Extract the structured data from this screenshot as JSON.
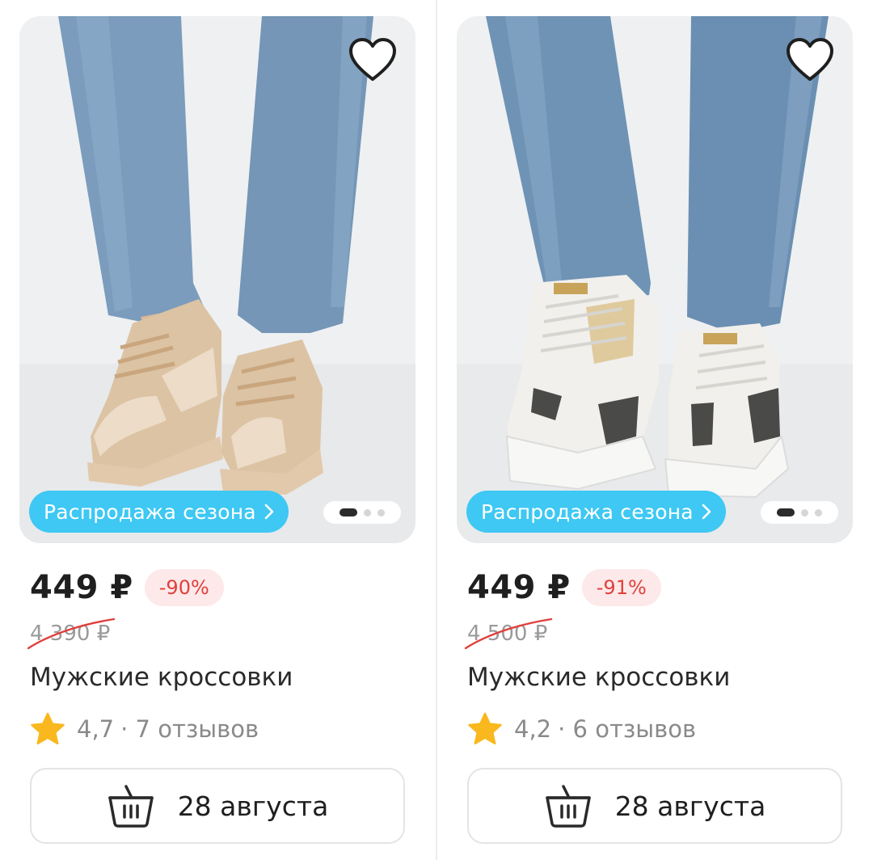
{
  "products": [
    {
      "promo_label": "Распродажа сезона",
      "price": "449 ₽",
      "discount": "-90%",
      "old_price": "4 390 ₽",
      "title": "Мужские кроссовки",
      "rating": "4,7",
      "reviews": "· 7 отзывов",
      "delivery": "28 августа",
      "gallery": {
        "pages": 3,
        "active": 1
      },
      "colors": {
        "shoe_main": "#dcc3a3",
        "shoe_accent": "#ecdcc8",
        "sole": "#e2c9ab",
        "accent_stripe": "#c9a67e"
      }
    },
    {
      "promo_label": "Распродажа сезона",
      "price": "449 ₽",
      "discount": "-91%",
      "old_price": "4 500 ₽",
      "title": "Мужские кроссовки",
      "rating": "4,2",
      "reviews": "· 6 отзывов",
      "delivery": "28 августа",
      "gallery": {
        "pages": 3,
        "active": 1
      },
      "colors": {
        "shoe_main": "#f2f0ec",
        "shoe_accent": "#ffffff",
        "sole": "#f4f4f2",
        "accent_stripe": "#c7a45a"
      }
    }
  ],
  "theme": {
    "promo_bg": "#3ec8f3",
    "discount_bg": "#fde9e9",
    "discount_text": "#e1403c",
    "star": "#f9b81e",
    "strike": "#e0403c",
    "jeans": "#6f93b5"
  },
  "icons": {
    "favorite": "heart-outline-icon",
    "cart": "basket-icon",
    "rating": "star-icon",
    "promo_chevron": "chevron-right-icon"
  }
}
